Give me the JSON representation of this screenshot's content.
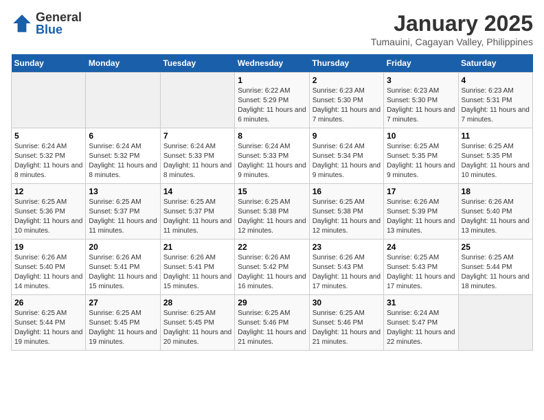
{
  "header": {
    "logo_general": "General",
    "logo_blue": "Blue",
    "month_title": "January 2025",
    "location": "Tumauini, Cagayan Valley, Philippines"
  },
  "weekdays": [
    "Sunday",
    "Monday",
    "Tuesday",
    "Wednesday",
    "Thursday",
    "Friday",
    "Saturday"
  ],
  "weeks": [
    [
      {
        "day": "",
        "sunrise": "",
        "sunset": "",
        "daylight": ""
      },
      {
        "day": "",
        "sunrise": "",
        "sunset": "",
        "daylight": ""
      },
      {
        "day": "",
        "sunrise": "",
        "sunset": "",
        "daylight": ""
      },
      {
        "day": "1",
        "sunrise": "Sunrise: 6:22 AM",
        "sunset": "Sunset: 5:29 PM",
        "daylight": "Daylight: 11 hours and 6 minutes."
      },
      {
        "day": "2",
        "sunrise": "Sunrise: 6:23 AM",
        "sunset": "Sunset: 5:30 PM",
        "daylight": "Daylight: 11 hours and 7 minutes."
      },
      {
        "day": "3",
        "sunrise": "Sunrise: 6:23 AM",
        "sunset": "Sunset: 5:30 PM",
        "daylight": "Daylight: 11 hours and 7 minutes."
      },
      {
        "day": "4",
        "sunrise": "Sunrise: 6:23 AM",
        "sunset": "Sunset: 5:31 PM",
        "daylight": "Daylight: 11 hours and 7 minutes."
      }
    ],
    [
      {
        "day": "5",
        "sunrise": "Sunrise: 6:24 AM",
        "sunset": "Sunset: 5:32 PM",
        "daylight": "Daylight: 11 hours and 8 minutes."
      },
      {
        "day": "6",
        "sunrise": "Sunrise: 6:24 AM",
        "sunset": "Sunset: 5:32 PM",
        "daylight": "Daylight: 11 hours and 8 minutes."
      },
      {
        "day": "7",
        "sunrise": "Sunrise: 6:24 AM",
        "sunset": "Sunset: 5:33 PM",
        "daylight": "Daylight: 11 hours and 8 minutes."
      },
      {
        "day": "8",
        "sunrise": "Sunrise: 6:24 AM",
        "sunset": "Sunset: 5:33 PM",
        "daylight": "Daylight: 11 hours and 9 minutes."
      },
      {
        "day": "9",
        "sunrise": "Sunrise: 6:24 AM",
        "sunset": "Sunset: 5:34 PM",
        "daylight": "Daylight: 11 hours and 9 minutes."
      },
      {
        "day": "10",
        "sunrise": "Sunrise: 6:25 AM",
        "sunset": "Sunset: 5:35 PM",
        "daylight": "Daylight: 11 hours and 9 minutes."
      },
      {
        "day": "11",
        "sunrise": "Sunrise: 6:25 AM",
        "sunset": "Sunset: 5:35 PM",
        "daylight": "Daylight: 11 hours and 10 minutes."
      }
    ],
    [
      {
        "day": "12",
        "sunrise": "Sunrise: 6:25 AM",
        "sunset": "Sunset: 5:36 PM",
        "daylight": "Daylight: 11 hours and 10 minutes."
      },
      {
        "day": "13",
        "sunrise": "Sunrise: 6:25 AM",
        "sunset": "Sunset: 5:37 PM",
        "daylight": "Daylight: 11 hours and 11 minutes."
      },
      {
        "day": "14",
        "sunrise": "Sunrise: 6:25 AM",
        "sunset": "Sunset: 5:37 PM",
        "daylight": "Daylight: 11 hours and 11 minutes."
      },
      {
        "day": "15",
        "sunrise": "Sunrise: 6:25 AM",
        "sunset": "Sunset: 5:38 PM",
        "daylight": "Daylight: 11 hours and 12 minutes."
      },
      {
        "day": "16",
        "sunrise": "Sunrise: 6:25 AM",
        "sunset": "Sunset: 5:38 PM",
        "daylight": "Daylight: 11 hours and 12 minutes."
      },
      {
        "day": "17",
        "sunrise": "Sunrise: 6:26 AM",
        "sunset": "Sunset: 5:39 PM",
        "daylight": "Daylight: 11 hours and 13 minutes."
      },
      {
        "day": "18",
        "sunrise": "Sunrise: 6:26 AM",
        "sunset": "Sunset: 5:40 PM",
        "daylight": "Daylight: 11 hours and 13 minutes."
      }
    ],
    [
      {
        "day": "19",
        "sunrise": "Sunrise: 6:26 AM",
        "sunset": "Sunset: 5:40 PM",
        "daylight": "Daylight: 11 hours and 14 minutes."
      },
      {
        "day": "20",
        "sunrise": "Sunrise: 6:26 AM",
        "sunset": "Sunset: 5:41 PM",
        "daylight": "Daylight: 11 hours and 15 minutes."
      },
      {
        "day": "21",
        "sunrise": "Sunrise: 6:26 AM",
        "sunset": "Sunset: 5:41 PM",
        "daylight": "Daylight: 11 hours and 15 minutes."
      },
      {
        "day": "22",
        "sunrise": "Sunrise: 6:26 AM",
        "sunset": "Sunset: 5:42 PM",
        "daylight": "Daylight: 11 hours and 16 minutes."
      },
      {
        "day": "23",
        "sunrise": "Sunrise: 6:26 AM",
        "sunset": "Sunset: 5:43 PM",
        "daylight": "Daylight: 11 hours and 17 minutes."
      },
      {
        "day": "24",
        "sunrise": "Sunrise: 6:25 AM",
        "sunset": "Sunset: 5:43 PM",
        "daylight": "Daylight: 11 hours and 17 minutes."
      },
      {
        "day": "25",
        "sunrise": "Sunrise: 6:25 AM",
        "sunset": "Sunset: 5:44 PM",
        "daylight": "Daylight: 11 hours and 18 minutes."
      }
    ],
    [
      {
        "day": "26",
        "sunrise": "Sunrise: 6:25 AM",
        "sunset": "Sunset: 5:44 PM",
        "daylight": "Daylight: 11 hours and 19 minutes."
      },
      {
        "day": "27",
        "sunrise": "Sunrise: 6:25 AM",
        "sunset": "Sunset: 5:45 PM",
        "daylight": "Daylight: 11 hours and 19 minutes."
      },
      {
        "day": "28",
        "sunrise": "Sunrise: 6:25 AM",
        "sunset": "Sunset: 5:45 PM",
        "daylight": "Daylight: 11 hours and 20 minutes."
      },
      {
        "day": "29",
        "sunrise": "Sunrise: 6:25 AM",
        "sunset": "Sunset: 5:46 PM",
        "daylight": "Daylight: 11 hours and 21 minutes."
      },
      {
        "day": "30",
        "sunrise": "Sunrise: 6:25 AM",
        "sunset": "Sunset: 5:46 PM",
        "daylight": "Daylight: 11 hours and 21 minutes."
      },
      {
        "day": "31",
        "sunrise": "Sunrise: 6:24 AM",
        "sunset": "Sunset: 5:47 PM",
        "daylight": "Daylight: 11 hours and 22 minutes."
      },
      {
        "day": "",
        "sunrise": "",
        "sunset": "",
        "daylight": ""
      }
    ]
  ]
}
